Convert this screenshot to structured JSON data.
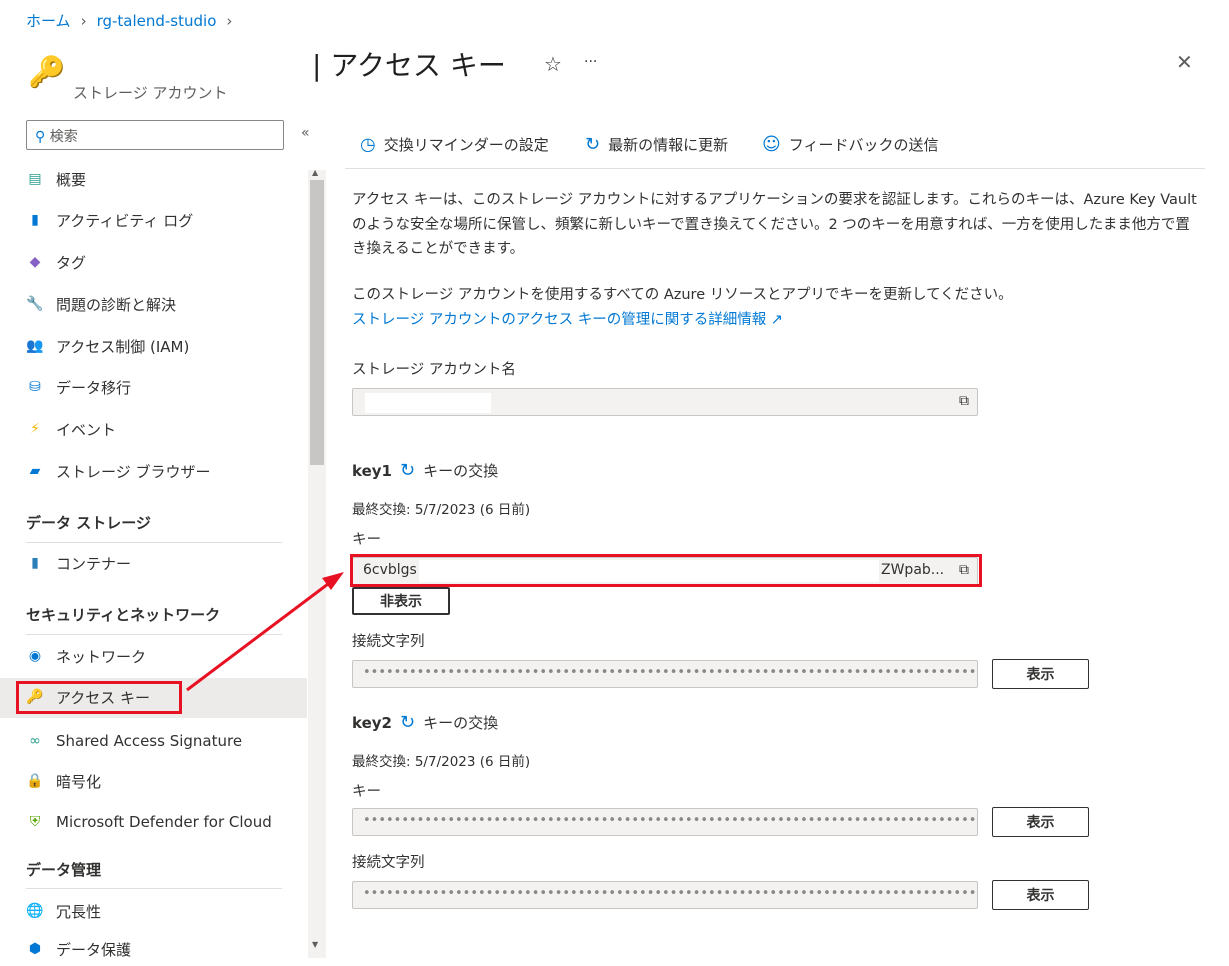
{
  "breadcrumb": {
    "home": "ホーム",
    "rg": "rg-talend-studio"
  },
  "header": {
    "title": "| アクセス キー",
    "subtitle": "ストレージ アカウント",
    "star": "☆",
    "more": "···",
    "close": "✕"
  },
  "sidebar": {
    "search_placeholder": "検索",
    "collapse": "«",
    "items": [
      {
        "label": "概要"
      },
      {
        "label": "アクティビティ ログ"
      },
      {
        "label": "タグ"
      },
      {
        "label": "問題の診断と解決"
      },
      {
        "label": "アクセス制御 (IAM)"
      },
      {
        "label": "データ移行"
      },
      {
        "label": "イベント"
      },
      {
        "label": "ストレージ ブラウザー"
      }
    ],
    "sections": [
      {
        "title": "データ ストレージ",
        "items": [
          {
            "label": "コンテナー"
          }
        ]
      },
      {
        "title": "セキュリティとネットワーク",
        "items": [
          {
            "label": "ネットワーク"
          },
          {
            "label": "アクセス キー"
          },
          {
            "label": "Shared Access Signature"
          },
          {
            "label": "暗号化"
          },
          {
            "label": "Microsoft Defender for Cloud"
          }
        ]
      },
      {
        "title": "データ管理",
        "items": [
          {
            "label": "冗長性"
          },
          {
            "label": "データ保護"
          }
        ]
      }
    ]
  },
  "toolbar": {
    "reminder": "交換リマインダーの設定",
    "refresh": "最新の情報に更新",
    "feedback": "フィードバックの送信"
  },
  "main": {
    "desc1": "アクセス キーは、このストレージ アカウントに対するアプリケーションの要求を認証します。これらのキーは、Azure Key Vault のような安全な場所に保管し、頻繁に新しいキーで置き換えてください。2 つのキーを用意すれば、一方を使用したまま他方で置き換えることができます。",
    "desc2": "このストレージ アカウントを使用するすべての Azure リソースとアプリでキーを更新してください。",
    "link": "ストレージ アカウントのアクセス キーの管理に関する詳細情報 ↗",
    "account_label": "ストレージ アカウント名",
    "key1": {
      "name": "key1",
      "rotate": "キーの交換",
      "last": "最終交換: 5/7/2023 (6 日前)",
      "key_label": "キー",
      "key_start": "6cvblgs",
      "key_end": "ZWpab...",
      "hide": "非表示",
      "conn_label": "接続文字列",
      "conn_value": "••••••••••••••••••••••••••••••••••••••••••••••••••••••••••••••••••••••••••••••••••••...",
      "show": "表示"
    },
    "key2": {
      "name": "key2",
      "rotate": "キーの交換",
      "last": "最終交換: 5/7/2023 (6 日前)",
      "key_label": "キー",
      "key_value": "••••••••••••••••••••••••••••••••••••••••••••••••••••••••••••••••••••••••••••••••••",
      "show": "表示",
      "conn_label": "接続文字列",
      "conn_value": "••••••••••••••••••••••••••••••••••••••••••••••••••••••••••••••••••••••••••••••••••••...",
      "show2": "表示"
    }
  },
  "colors": {
    "accent": "#0078d4",
    "highlight": "#e81123"
  }
}
